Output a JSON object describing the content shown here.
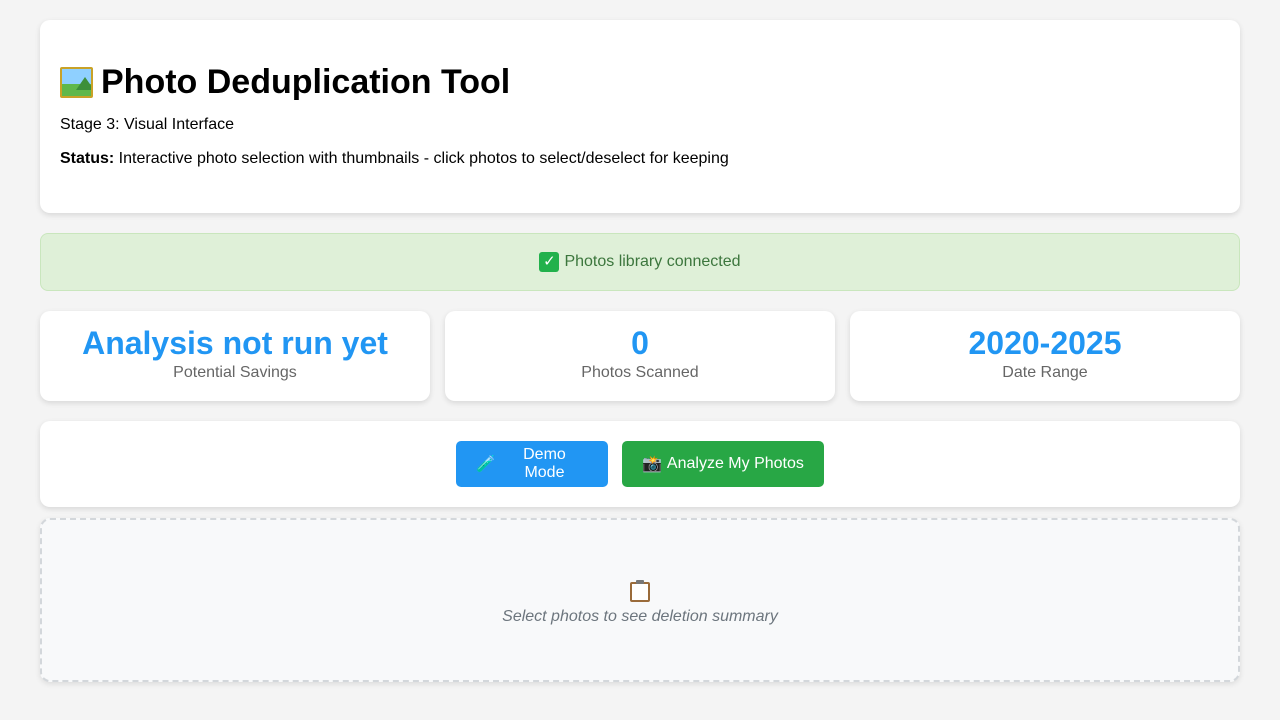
{
  "header": {
    "icon": "framed-picture-icon",
    "title": "Photo Deduplication Tool",
    "subtitle": "Stage 3: Visual Interface",
    "status_label": "Status:",
    "status_text": " Interactive photo selection with thumbnails - click photos to select/deselect for keeping"
  },
  "banner": {
    "icon": "check-mark-icon",
    "text": "Photos library connected"
  },
  "stats": [
    {
      "value": "Analysis not run yet",
      "label": "Potential Savings"
    },
    {
      "value": "0",
      "label": "Photos Scanned"
    },
    {
      "value": "2020-2025",
      "label": "Date Range"
    }
  ],
  "actions": {
    "demo_icon": "test-tube-icon",
    "demo_label": "Demo Mode",
    "analyze_icon": "camera-flash-icon",
    "analyze_label": "Analyze My Photos"
  },
  "summary": {
    "icon": "clipboard-icon",
    "text": "Select photos to see deletion summary"
  },
  "colors": {
    "accent": "#2196f3",
    "success": "#28a745",
    "banner_bg": "#dff0d8",
    "banner_text": "#3c763d"
  }
}
